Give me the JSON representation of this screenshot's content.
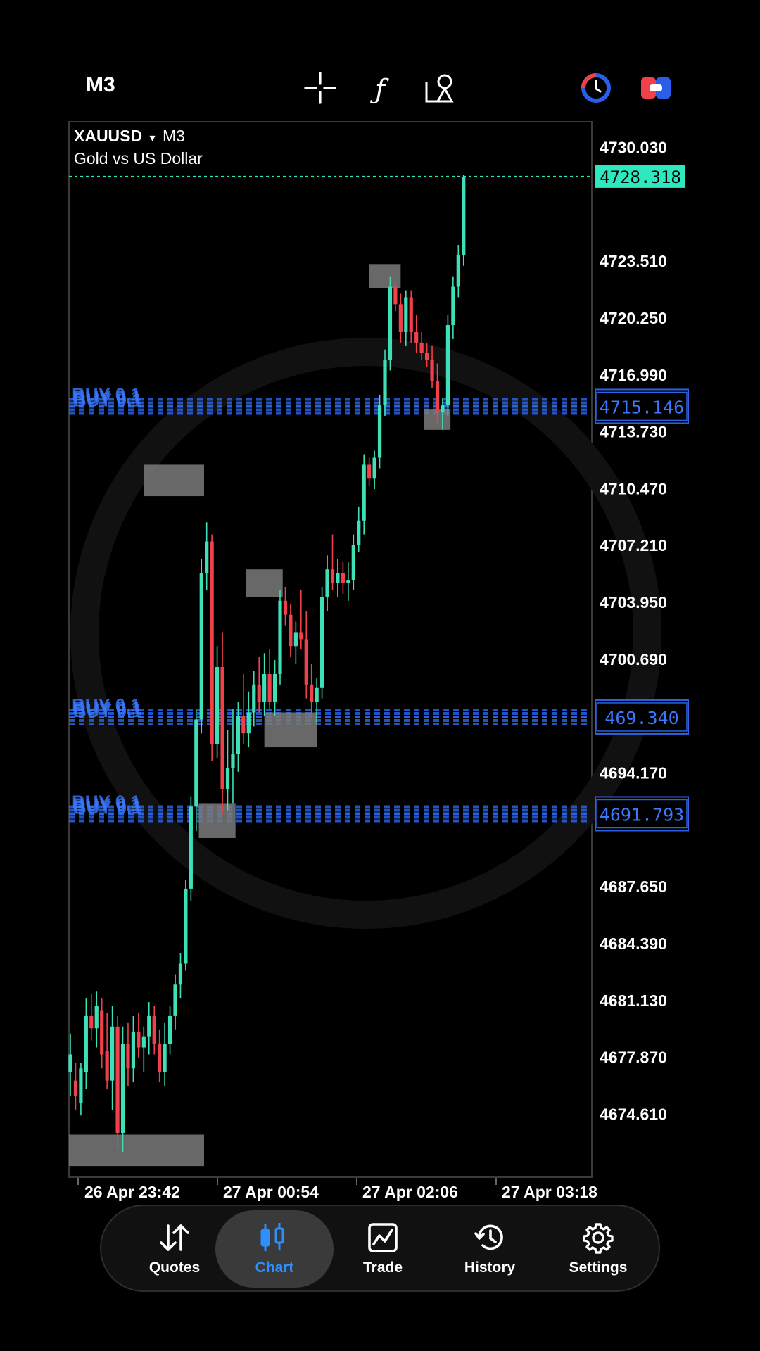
{
  "toolbar": {
    "timeframe": "M3",
    "icons": [
      "crosshair-icon",
      "function-icon",
      "objects-icon",
      "one-click-trading-icon",
      "account-toggle-icon"
    ]
  },
  "chart_header": {
    "symbol": "XAUUSD",
    "dropdown_glyph": "▾",
    "timeframe": "M3",
    "description": "Gold vs US Dollar"
  },
  "chart_data": {
    "type": "candlestick",
    "symbol": "XAUUSD",
    "ylim": [
      4671.0,
      4731.5
    ],
    "price_ticks": [
      4730.03,
      4723.51,
      4720.25,
      4716.99,
      4713.73,
      4710.47,
      4707.21,
      4703.95,
      4700.69,
      4694.17,
      4687.65,
      4684.39,
      4681.13,
      4677.87,
      4674.61
    ],
    "time_labels": [
      "26 Apr 23:42",
      "27 Apr 00:54",
      "27 Apr 02:06",
      "27 Apr 03:18"
    ],
    "current_price": 4728.318,
    "current_price_label": "4728.318",
    "orders": [
      {
        "label": "BUY 0.1",
        "price": 4715.146,
        "price_label": "4715.146"
      },
      {
        "label": "BUY 0.1",
        "price": 4697.34,
        "price_label": "469.340"
      },
      {
        "label": "BUY 0.1",
        "price": 4691.793,
        "price_label": "4691.793"
      }
    ],
    "candles": [
      {
        "o": 4677.0,
        "h": 4679.2,
        "l": 4675.6,
        "c": 4678.0
      },
      {
        "o": 4676.5,
        "h": 4677.5,
        "l": 4674.8,
        "c": 4675.6
      },
      {
        "o": 4675.2,
        "h": 4677.5,
        "l": 4674.5,
        "c": 4677.2
      },
      {
        "o": 4677.0,
        "h": 4681.2,
        "l": 4676.0,
        "c": 4680.2
      },
      {
        "o": 4680.2,
        "h": 4681.5,
        "l": 4678.8,
        "c": 4679.5
      },
      {
        "o": 4679.5,
        "h": 4681.6,
        "l": 4678.4,
        "c": 4680.8
      },
      {
        "o": 4680.5,
        "h": 4681.2,
        "l": 4677.2,
        "c": 4678.0
      },
      {
        "o": 4678.2,
        "h": 4680.4,
        "l": 4676.0,
        "c": 4676.5
      },
      {
        "o": 4676.5,
        "h": 4680.8,
        "l": 4674.8,
        "c": 4679.6
      },
      {
        "o": 4679.6,
        "h": 4680.2,
        "l": 4672.6,
        "c": 4673.5
      },
      {
        "o": 4673.5,
        "h": 4679.6,
        "l": 4672.4,
        "c": 4678.6
      },
      {
        "o": 4678.6,
        "h": 4679.8,
        "l": 4676.2,
        "c": 4677.2
      },
      {
        "o": 4677.2,
        "h": 4680.2,
        "l": 4676.4,
        "c": 4679.3
      },
      {
        "o": 4679.3,
        "h": 4680.4,
        "l": 4677.8,
        "c": 4678.4
      },
      {
        "o": 4678.4,
        "h": 4679.6,
        "l": 4677.0,
        "c": 4679.0
      },
      {
        "o": 4679.0,
        "h": 4681.0,
        "l": 4678.0,
        "c": 4680.2
      },
      {
        "o": 4680.2,
        "h": 4680.8,
        "l": 4678.0,
        "c": 4678.6
      },
      {
        "o": 4678.6,
        "h": 4679.4,
        "l": 4676.4,
        "c": 4677.0
      },
      {
        "o": 4677.0,
        "h": 4679.8,
        "l": 4676.2,
        "c": 4678.6
      },
      {
        "o": 4678.6,
        "h": 4680.8,
        "l": 4678.0,
        "c": 4680.2
      },
      {
        "o": 4680.2,
        "h": 4682.6,
        "l": 4679.4,
        "c": 4682.0
      },
      {
        "o": 4682.0,
        "h": 4683.8,
        "l": 4681.2,
        "c": 4683.2
      },
      {
        "o": 4683.2,
        "h": 4688.0,
        "l": 4682.8,
        "c": 4687.5
      },
      {
        "o": 4687.5,
        "h": 4692.8,
        "l": 4686.8,
        "c": 4692.2
      },
      {
        "o": 4692.2,
        "h": 4697.8,
        "l": 4690.8,
        "c": 4697.2
      },
      {
        "o": 4697.2,
        "h": 4706.4,
        "l": 4696.4,
        "c": 4705.6
      },
      {
        "o": 4705.6,
        "h": 4708.5,
        "l": 4704.6,
        "c": 4707.4
      },
      {
        "o": 4707.4,
        "h": 4707.8,
        "l": 4694.8,
        "c": 4695.8
      },
      {
        "o": 4695.8,
        "h": 4701.4,
        "l": 4695.0,
        "c": 4700.2
      },
      {
        "o": 4700.2,
        "h": 4702.2,
        "l": 4691.8,
        "c": 4693.2
      },
      {
        "o": 4693.2,
        "h": 4696.6,
        "l": 4692.0,
        "c": 4694.4
      },
      {
        "o": 4694.4,
        "h": 4697.8,
        "l": 4692.4,
        "c": 4695.2
      },
      {
        "o": 4695.2,
        "h": 4698.2,
        "l": 4694.2,
        "c": 4697.4
      },
      {
        "o": 4697.4,
        "h": 4699.8,
        "l": 4695.8,
        "c": 4696.4
      },
      {
        "o": 4696.4,
        "h": 4698.8,
        "l": 4695.6,
        "c": 4697.6
      },
      {
        "o": 4697.6,
        "h": 4700.0,
        "l": 4696.8,
        "c": 4699.2
      },
      {
        "o": 4699.2,
        "h": 4700.8,
        "l": 4697.6,
        "c": 4698.2
      },
      {
        "o": 4698.2,
        "h": 4701.0,
        "l": 4697.4,
        "c": 4699.8
      },
      {
        "o": 4699.8,
        "h": 4701.2,
        "l": 4697.8,
        "c": 4698.2
      },
      {
        "o": 4698.2,
        "h": 4700.6,
        "l": 4697.4,
        "c": 4699.8
      },
      {
        "o": 4699.8,
        "h": 4704.6,
        "l": 4699.2,
        "c": 4704.0
      },
      {
        "o": 4704.0,
        "h": 4704.8,
        "l": 4702.6,
        "c": 4703.2
      },
      {
        "o": 4703.2,
        "h": 4703.8,
        "l": 4700.8,
        "c": 4701.4
      },
      {
        "o": 4701.4,
        "h": 4702.8,
        "l": 4700.4,
        "c": 4702.2
      },
      {
        "o": 4702.2,
        "h": 4704.6,
        "l": 4701.2,
        "c": 4701.8
      },
      {
        "o": 4701.8,
        "h": 4703.4,
        "l": 4698.4,
        "c": 4699.2
      },
      {
        "o": 4699.2,
        "h": 4700.4,
        "l": 4697.2,
        "c": 4698.2
      },
      {
        "o": 4698.2,
        "h": 4699.6,
        "l": 4697.0,
        "c": 4699.0
      },
      {
        "o": 4699.0,
        "h": 4704.8,
        "l": 4698.4,
        "c": 4704.2
      },
      {
        "o": 4704.2,
        "h": 4706.6,
        "l": 4703.4,
        "c": 4705.8
      },
      {
        "o": 4705.8,
        "h": 4707.8,
        "l": 4704.6,
        "c": 4705.0
      },
      {
        "o": 4705.0,
        "h": 4706.4,
        "l": 4704.2,
        "c": 4705.6
      },
      {
        "o": 4705.6,
        "h": 4706.2,
        "l": 4704.4,
        "c": 4705.0
      },
      {
        "o": 4705.0,
        "h": 4706.2,
        "l": 4704.0,
        "c": 4705.2
      },
      {
        "o": 4705.2,
        "h": 4707.8,
        "l": 4704.6,
        "c": 4707.2
      },
      {
        "o": 4707.2,
        "h": 4709.4,
        "l": 4706.8,
        "c": 4708.6
      },
      {
        "o": 4708.6,
        "h": 4712.4,
        "l": 4707.8,
        "c": 4711.8
      },
      {
        "o": 4711.8,
        "h": 4712.2,
        "l": 4710.6,
        "c": 4711.0
      },
      {
        "o": 4711.0,
        "h": 4712.6,
        "l": 4710.4,
        "c": 4712.2
      },
      {
        "o": 4712.2,
        "h": 4715.8,
        "l": 4711.6,
        "c": 4715.2
      },
      {
        "o": 4715.2,
        "h": 4718.4,
        "l": 4714.6,
        "c": 4717.8
      },
      {
        "o": 4717.8,
        "h": 4722.6,
        "l": 4717.2,
        "c": 4722.0
      },
      {
        "o": 4722.0,
        "h": 4722.4,
        "l": 4720.6,
        "c": 4721.0
      },
      {
        "o": 4721.0,
        "h": 4721.6,
        "l": 4718.8,
        "c": 4719.4
      },
      {
        "o": 4719.4,
        "h": 4721.8,
        "l": 4718.6,
        "c": 4721.4
      },
      {
        "o": 4721.4,
        "h": 4721.8,
        "l": 4718.8,
        "c": 4719.4
      },
      {
        "o": 4719.4,
        "h": 4720.4,
        "l": 4718.2,
        "c": 4718.8
      },
      {
        "o": 4718.8,
        "h": 4719.4,
        "l": 4717.8,
        "c": 4718.2
      },
      {
        "o": 4718.2,
        "h": 4718.8,
        "l": 4717.4,
        "c": 4717.8
      },
      {
        "o": 4717.8,
        "h": 4718.6,
        "l": 4716.2,
        "c": 4716.6
      },
      {
        "o": 4716.6,
        "h": 4717.6,
        "l": 4714.2,
        "c": 4714.8
      },
      {
        "o": 4714.8,
        "h": 4715.6,
        "l": 4713.8,
        "c": 4715.2
      },
      {
        "o": 4715.2,
        "h": 4720.4,
        "l": 4714.6,
        "c": 4719.8
      },
      {
        "o": 4719.8,
        "h": 4722.6,
        "l": 4719.0,
        "c": 4722.0
      },
      {
        "o": 4722.0,
        "h": 4724.4,
        "l": 4721.4,
        "c": 4723.8
      },
      {
        "o": 4723.8,
        "h": 4728.4,
        "l": 4723.2,
        "c": 4728.3
      }
    ],
    "zones": [
      {
        "i0": 14,
        "i1": 25.5,
        "p0": 4710.0,
        "p1": 4711.8
      },
      {
        "i0": 33.5,
        "i1": 40.5,
        "p0": 4704.2,
        "p1": 4705.8
      },
      {
        "i0": 37,
        "i1": 47,
        "p0": 4695.6,
        "p1": 4697.6
      },
      {
        "i0": 24.5,
        "i1": 31.5,
        "p0": 4690.4,
        "p1": 4692.4
      },
      {
        "i0": -2,
        "i1": 25.5,
        "p0": 4671.6,
        "p1": 4673.4
      },
      {
        "i0": 57,
        "i1": 63,
        "p0": 4721.9,
        "p1": 4723.3
      },
      {
        "i0": 67.5,
        "i1": 72.5,
        "p0": 4713.8,
        "p1": 4715.0
      }
    ]
  },
  "nav": {
    "items": [
      {
        "label": "Quotes",
        "icon": "quotes-icon"
      },
      {
        "label": "Chart",
        "icon": "chart-icon",
        "active": true
      },
      {
        "label": "Trade",
        "icon": "trade-icon"
      },
      {
        "label": "History",
        "icon": "history-icon"
      },
      {
        "label": "Settings",
        "icon": "settings-icon"
      }
    ]
  },
  "colors": {
    "bull": "#3ee0b8",
    "bear": "#f0404a",
    "order_line": "#2a62e0",
    "order_text": "#3a78ff",
    "current_price": "#2fe8c0",
    "nav_active": "#2e8fff"
  }
}
